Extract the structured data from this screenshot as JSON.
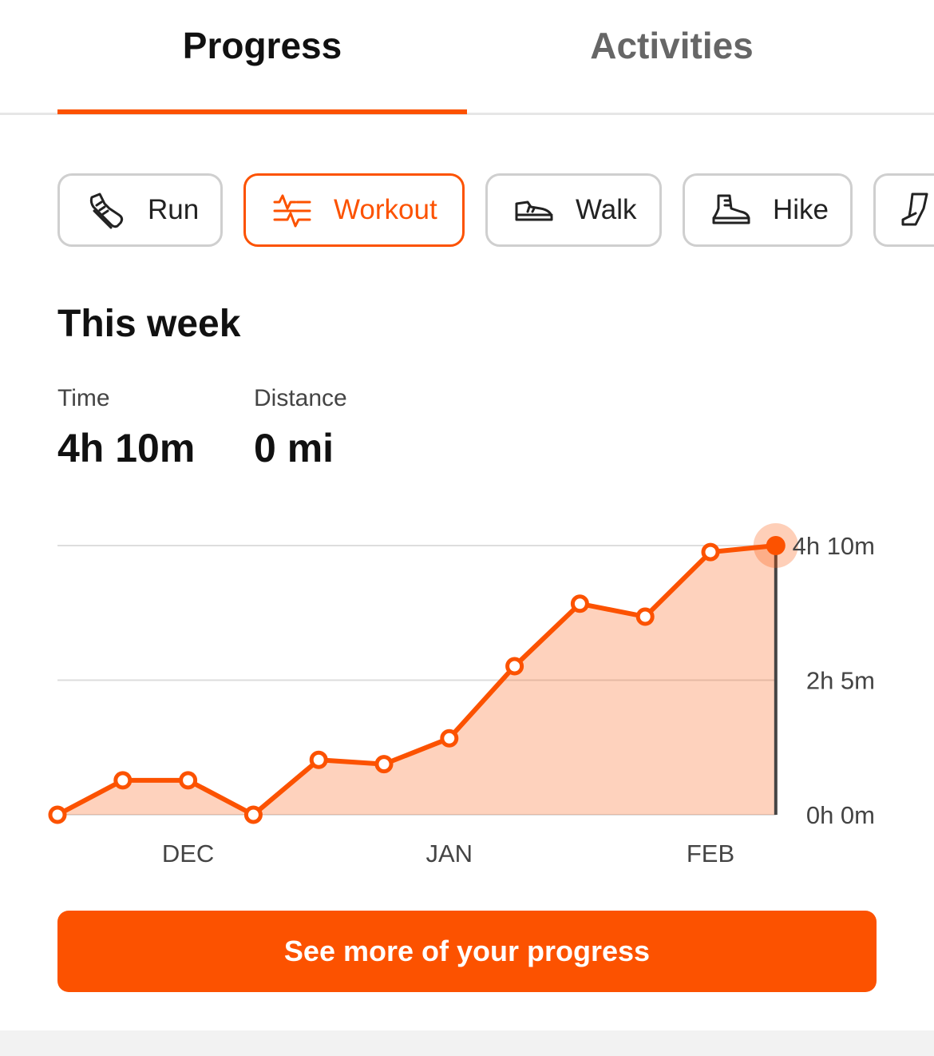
{
  "tabs": [
    {
      "label": "Progress",
      "active": true
    },
    {
      "label": "Activities",
      "active": false
    }
  ],
  "accent_color": "#fc5200",
  "filters": [
    {
      "label": "Run",
      "icon": "running-shoe-icon",
      "selected": false
    },
    {
      "label": "Workout",
      "icon": "workout-icon",
      "selected": true
    },
    {
      "label": "Walk",
      "icon": "walking-shoe-icon",
      "selected": false
    },
    {
      "label": "Hike",
      "icon": "hiking-boot-icon",
      "selected": false
    },
    {
      "label": "",
      "icon": "leg-icon",
      "selected": false
    }
  ],
  "section_title": "This week",
  "stats": {
    "time_label": "Time",
    "time_value": "4h 10m",
    "distance_label": "Distance",
    "distance_value": "0 mi"
  },
  "chart_data": {
    "type": "area",
    "x_labels": [
      "DEC",
      "JAN",
      "FEB"
    ],
    "x_label_positions": [
      2,
      6,
      10
    ],
    "y_tick_labels": [
      "0h 0m",
      "2h 5m",
      "4h 10m"
    ],
    "y_tick_values": [
      0,
      125,
      250
    ],
    "ylim": [
      0,
      250
    ],
    "series": [
      {
        "values_minutes": [
          0,
          32,
          32,
          0,
          51,
          47,
          71,
          138,
          196,
          184,
          244,
          250
        ]
      }
    ],
    "highlighted_point_index": 11,
    "grid": true
  },
  "cta_label": "See more of your progress"
}
